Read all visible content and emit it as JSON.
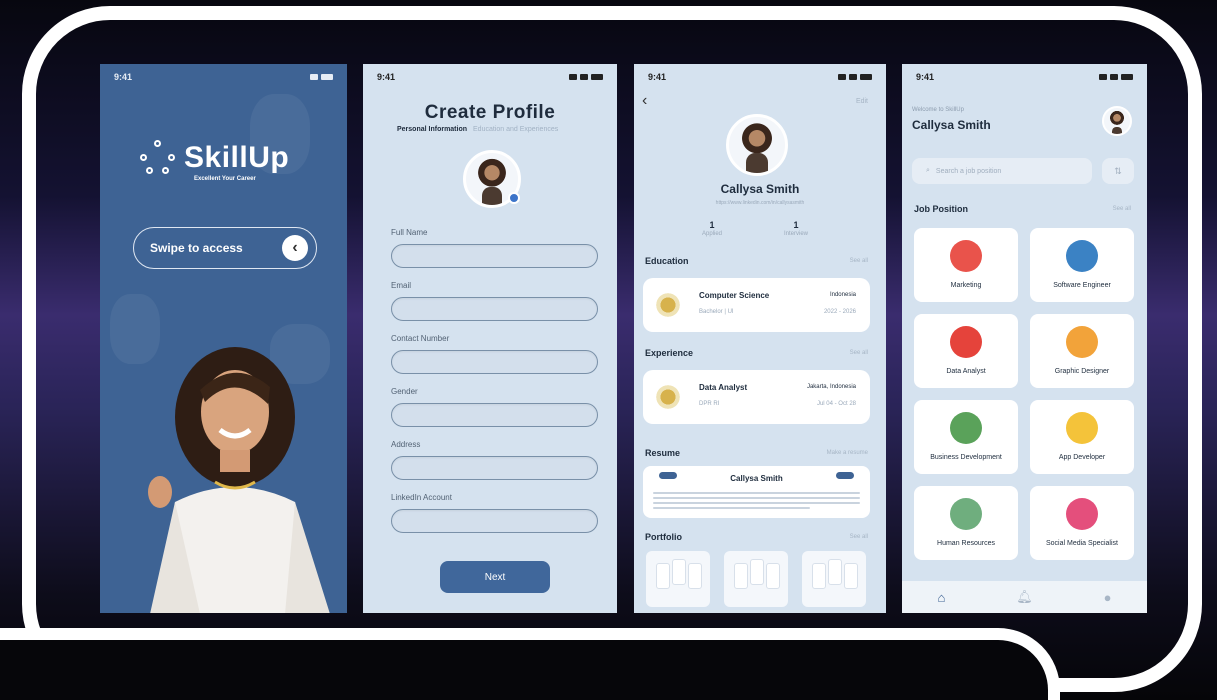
{
  "status_time": "9:41",
  "colors": {
    "brand": "#3e6394",
    "screen_bg": "#d5e2ef",
    "frame": "#ffffff"
  },
  "splash": {
    "logo": "SkillUp",
    "tagline": "Excellent Your Career",
    "swipe_label": "Swipe to access",
    "swipe_icon": "chevron-left-icon"
  },
  "create_profile": {
    "title": "Create Profile",
    "tab_active": "Personal Information",
    "tab_inactive": "Education and Experiences",
    "fields": [
      {
        "label": "Full Name"
      },
      {
        "label": "Email"
      },
      {
        "label": "Contact Number"
      },
      {
        "label": "Gender"
      },
      {
        "label": "Address"
      },
      {
        "label": "LinkedIn Account"
      }
    ],
    "next_label": "Next"
  },
  "profile": {
    "edit_label": "Edit",
    "name": "Callysa Smith",
    "link": "https://www.linkedin.com/in/callysasmith",
    "stats": [
      {
        "value": "1",
        "label": "Applied"
      },
      {
        "value": "1",
        "label": "Interview"
      }
    ],
    "education_title": "Education",
    "see_all": "See all",
    "education": {
      "title": "Computer Science",
      "subtitle": "Bachelor | UI",
      "location": "Indonesia",
      "period": "2022 - 2026"
    },
    "experience_title": "Experience",
    "experience": {
      "title": "Data Analyst",
      "subtitle": "DPR RI",
      "location": "Jakarta, Indonesia",
      "period": "Jul 04 - Oct 28"
    },
    "resume_title": "Resume",
    "resume_action": "Make a resume",
    "resume_name": "Callysa Smith",
    "portfolio_title": "Portfolio"
  },
  "home": {
    "welcome": "Welcome to SkillUp",
    "name": "Callysa Smith",
    "search_placeholder": "Search a job position",
    "job_position_title": "Job Position",
    "see_all": "See all",
    "jobs": [
      {
        "label": "Marketing",
        "icon": "marketing-icon",
        "color": "#e9534b"
      },
      {
        "label": "Software Engineer",
        "icon": "software-engineer-icon",
        "color": "#3b82c4"
      },
      {
        "label": "Data Analyst",
        "icon": "data-analyst-icon",
        "color": "#e5433b"
      },
      {
        "label": "Graphic Designer",
        "icon": "graphic-designer-icon",
        "color": "#f2a33a"
      },
      {
        "label": "Business Development",
        "icon": "business-development-icon",
        "color": "#5aa25a"
      },
      {
        "label": "App Developer",
        "icon": "app-developer-icon",
        "color": "#f4c33a"
      },
      {
        "label": "Human Resources",
        "icon": "human-resources-icon",
        "color": "#6fae7e"
      },
      {
        "label": "Social Media Specialist",
        "icon": "social-media-icon",
        "color": "#e44f7c"
      }
    ]
  }
}
